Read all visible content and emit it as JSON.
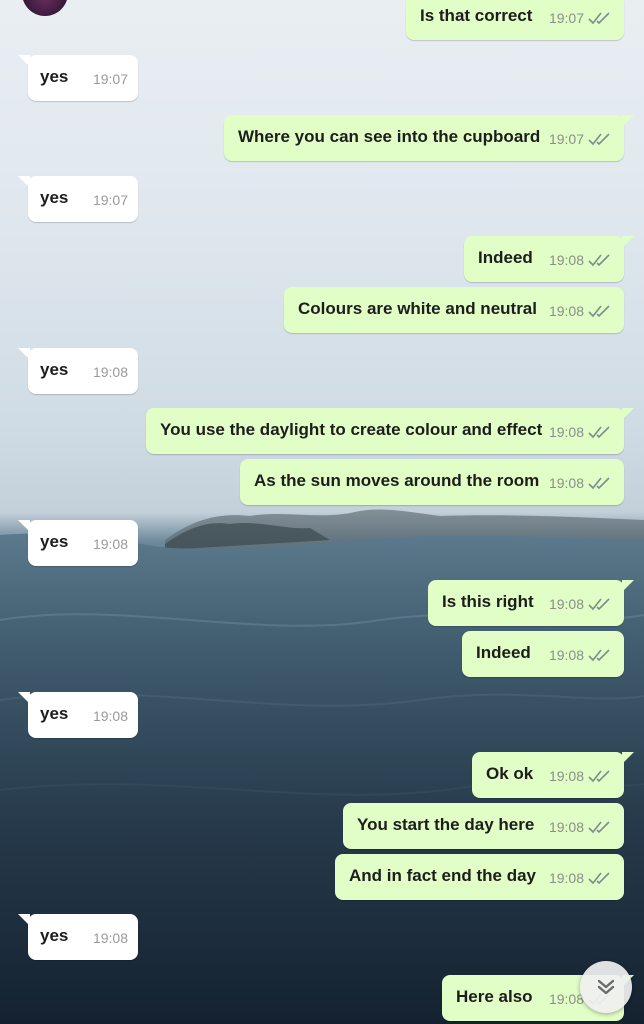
{
  "conversation": {
    "messages": [
      {
        "side": "out",
        "text": "Is that correct",
        "time": "19:07",
        "tail": false
      },
      {
        "side": "in",
        "text": "yes",
        "time": "19:07",
        "tail": true
      },
      {
        "side": "out",
        "text": "Where you can see into the cupboard",
        "time": "19:07",
        "tail": true
      },
      {
        "side": "in",
        "text": "yes",
        "time": "19:07",
        "tail": true
      },
      {
        "side": "out",
        "text": "Indeed",
        "time": "19:08",
        "tail": true
      },
      {
        "side": "out",
        "text": "Colours are white and neutral",
        "time": "19:08",
        "tail": false
      },
      {
        "side": "in",
        "text": "yes",
        "time": "19:08",
        "tail": true
      },
      {
        "side": "out",
        "text": "You use the daylight to create colour and effect",
        "time": "19:08",
        "tail": true
      },
      {
        "side": "out",
        "text": "As the sun moves around the room",
        "time": "19:08",
        "tail": false
      },
      {
        "side": "in",
        "text": "yes",
        "time": "19:08",
        "tail": true
      },
      {
        "side": "out",
        "text": "Is this right",
        "time": "19:08",
        "tail": true
      },
      {
        "side": "out",
        "text": "Indeed",
        "time": "19:08",
        "tail": false
      },
      {
        "side": "in",
        "text": "yes",
        "time": "19:08",
        "tail": true
      },
      {
        "side": "out",
        "text": "Ok ok",
        "time": "19:08",
        "tail": true
      },
      {
        "side": "out",
        "text": "You start the day here",
        "time": "19:08",
        "tail": false
      },
      {
        "side": "out",
        "text": "And in fact end the day",
        "time": "19:08",
        "tail": false
      },
      {
        "side": "in",
        "text": "yes",
        "time": "19:08",
        "tail": true
      },
      {
        "side": "out",
        "text": "Here also",
        "time": "19:08",
        "tail": true
      }
    ]
  },
  "controls": {
    "scroll_down_icon": "chevron-double-down-icon"
  },
  "colors": {
    "outgoing_bubble": "#e1fec6",
    "incoming_bubble": "#ffffff",
    "tick_color": "#7f8c8d"
  }
}
